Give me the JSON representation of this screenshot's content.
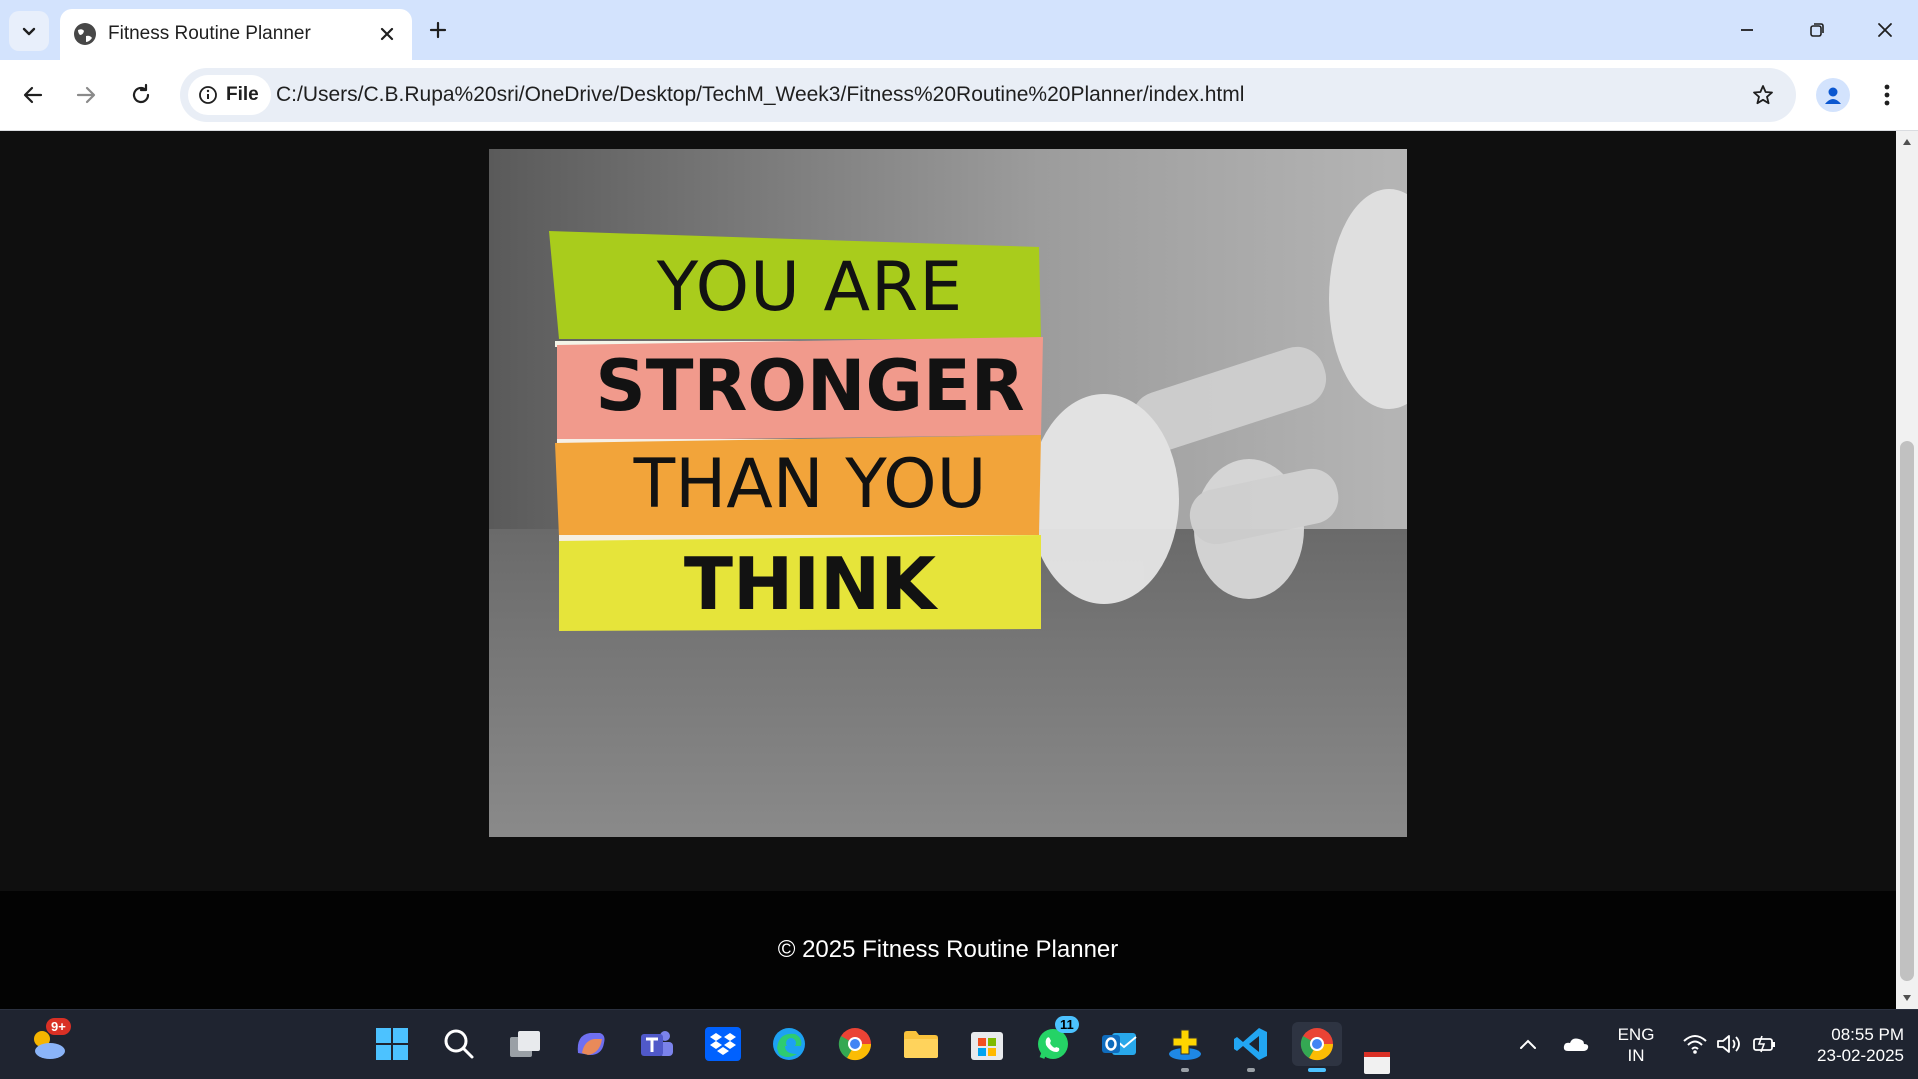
{
  "browser": {
    "tab_title": "Fitness Routine Planner",
    "address_chip": "File",
    "url": "C:/Users/C.B.Rupa%20sri/OneDrive/Desktop/TechM_Week3/Fitness%20Routine%20Planner/index.html"
  },
  "page": {
    "hero_image": {
      "lines": [
        "YOU ARE",
        "STRONGER",
        "THAN YOU",
        "THINK"
      ],
      "book_colors": [
        "#a9cc1c",
        "#f19a8c",
        "#f2a43a",
        "#e6e43a"
      ]
    },
    "footer_text": "© 2025 Fitness Routine Planner"
  },
  "taskbar": {
    "weather_badge": "9+",
    "whatsapp_badge": "11",
    "language_line1": "ENG",
    "language_line2": "IN",
    "time": "08:55 PM",
    "date": "23-02-2025"
  },
  "colors": {
    "tab_strip": "#d3e3fd",
    "page_background": "#0f0f0f",
    "footer_background": "#030303",
    "taskbar": "#1f2430",
    "accent": "#4cc2ff"
  }
}
